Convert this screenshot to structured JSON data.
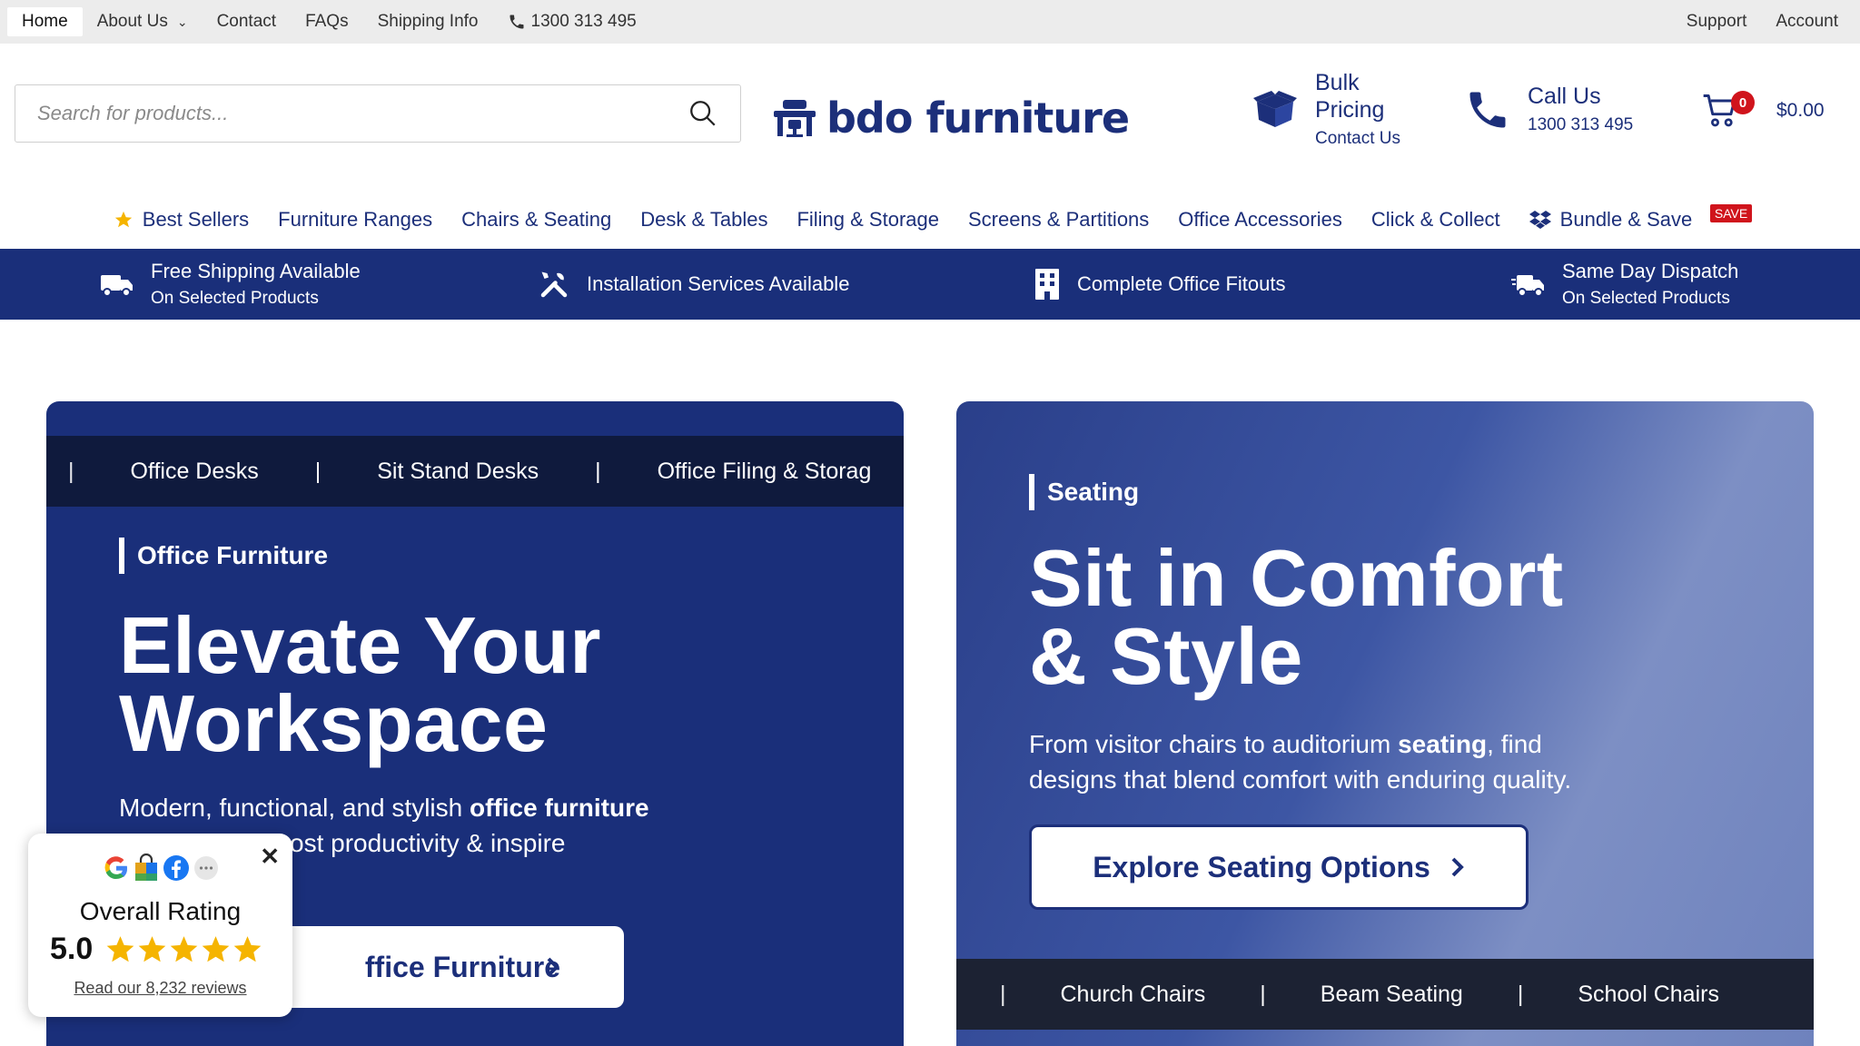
{
  "topbar": {
    "links": [
      "Home",
      "About Us",
      "Contact",
      "FAQs",
      "Shipping Info"
    ],
    "phone": "1300 313 495",
    "right": [
      "Support",
      "Account"
    ]
  },
  "header": {
    "search_placeholder": "Search for products...",
    "logo_text": "bdo furniture",
    "bulk_line1": "Bulk",
    "bulk_line2": "Pricing",
    "bulk_sub": "Contact Us",
    "call_title": "Call Us",
    "call_number": "1300 313 495",
    "cart_count": "0",
    "cart_total": "$0.00"
  },
  "nav": {
    "items": [
      "Best Sellers",
      "Furniture Ranges",
      "Chairs & Seating",
      "Desk & Tables",
      "Filing & Storage",
      "Screens & Partitions",
      "Office Accessories",
      "Click & Collect",
      "Bundle & Save"
    ],
    "save_badge": "SAVE"
  },
  "features": [
    {
      "title": "Free Shipping Available",
      "sub": "On Selected Products"
    },
    {
      "title": "Installation Services Available",
      "sub": ""
    },
    {
      "title": "Complete Office Fitouts",
      "sub": ""
    },
    {
      "title": "Same Day Dispatch",
      "sub": "On Selected Products"
    }
  ],
  "hero_left": {
    "strip": [
      "Office Desks",
      "Sit Stand Desks",
      "Office Filing & Storag"
    ],
    "eyebrow": "Office Furniture",
    "headline1": "Elevate Your",
    "headline2": "Workspace",
    "para_pre": "Modern, functional, and stylish ",
    "para_bold": "office furniture",
    "para_line2": "ost productivity & inspire",
    "button": "ffice Furniture"
  },
  "hero_right": {
    "eyebrow": "Seating",
    "headline1": "Sit in Comfort",
    "headline2": "& Style",
    "para_pre": "From visitor chairs to auditorium ",
    "para_bold": "seating",
    "para_post": ", find",
    "para_line2": "designs that blend comfort with enduring quality.",
    "button": "Explore Seating Options",
    "strip": [
      "Church Chairs",
      "Beam Seating",
      "School Chairs"
    ]
  },
  "rating": {
    "title": "Overall Rating",
    "score": "5.0",
    "stars": 5,
    "reviews": "Read our 8,232 reviews"
  },
  "colors": {
    "brand_navy": "#1a2f7a",
    "dark_strip": "#0f1a3d",
    "sale_red": "#d0141c",
    "star_gold": "#f5b400"
  }
}
